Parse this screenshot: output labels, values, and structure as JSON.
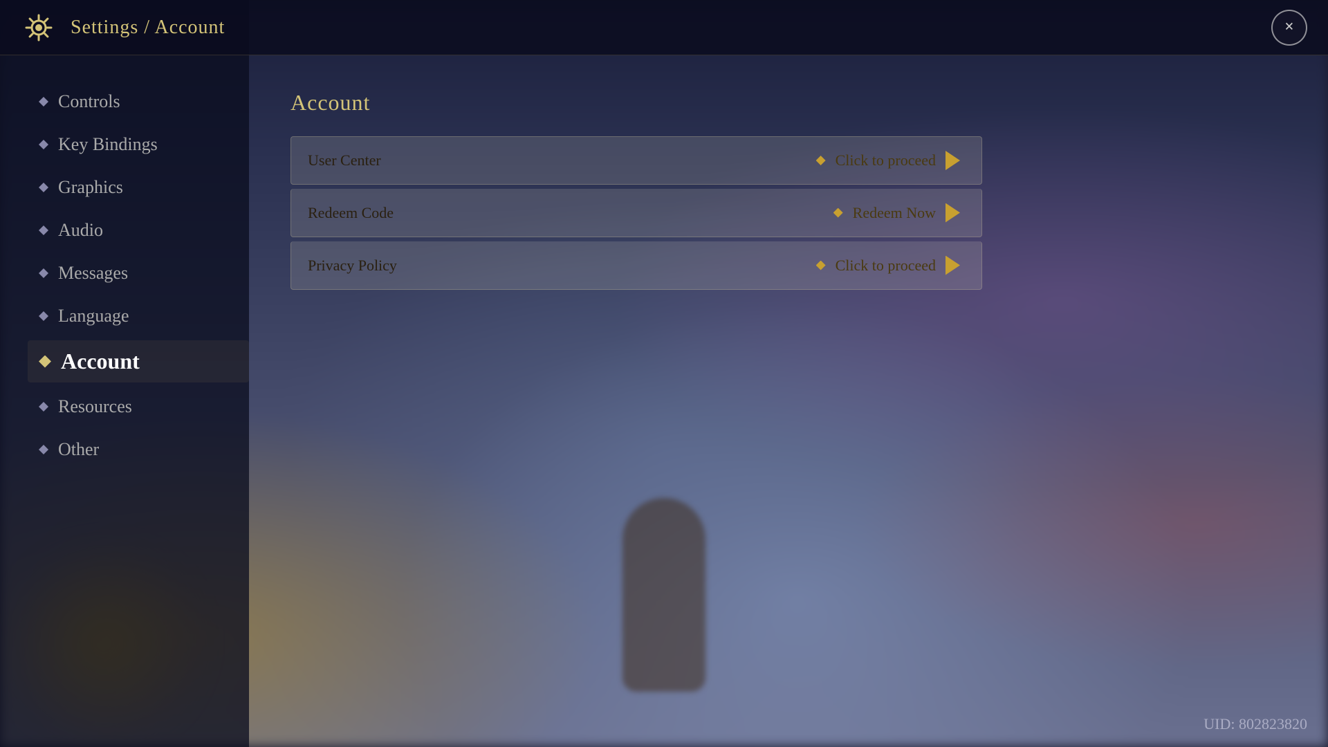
{
  "header": {
    "title": "Settings / Account",
    "close_label": "×",
    "icon_alt": "settings-gear-icon"
  },
  "sidebar": {
    "items": [
      {
        "id": "controls",
        "label": "Controls",
        "active": false
      },
      {
        "id": "key-bindings",
        "label": "Key Bindings",
        "active": false
      },
      {
        "id": "graphics",
        "label": "Graphics",
        "active": false
      },
      {
        "id": "audio",
        "label": "Audio",
        "active": false
      },
      {
        "id": "messages",
        "label": "Messages",
        "active": false
      },
      {
        "id": "language",
        "label": "Language",
        "active": false
      },
      {
        "id": "account",
        "label": "Account",
        "active": true
      },
      {
        "id": "resources",
        "label": "Resources",
        "active": false
      },
      {
        "id": "other",
        "label": "Other",
        "active": false
      }
    ]
  },
  "main": {
    "section_title": "Account",
    "rows": [
      {
        "id": "user-center",
        "left_label": "User Center",
        "right_label": "Click to proceed"
      },
      {
        "id": "redeem-code",
        "left_label": "Redeem Code",
        "right_label": "Redeem Now"
      },
      {
        "id": "privacy-policy",
        "left_label": "Privacy Policy",
        "right_label": "Click to proceed"
      }
    ]
  },
  "footer": {
    "uid_label": "UID: 802823820"
  }
}
